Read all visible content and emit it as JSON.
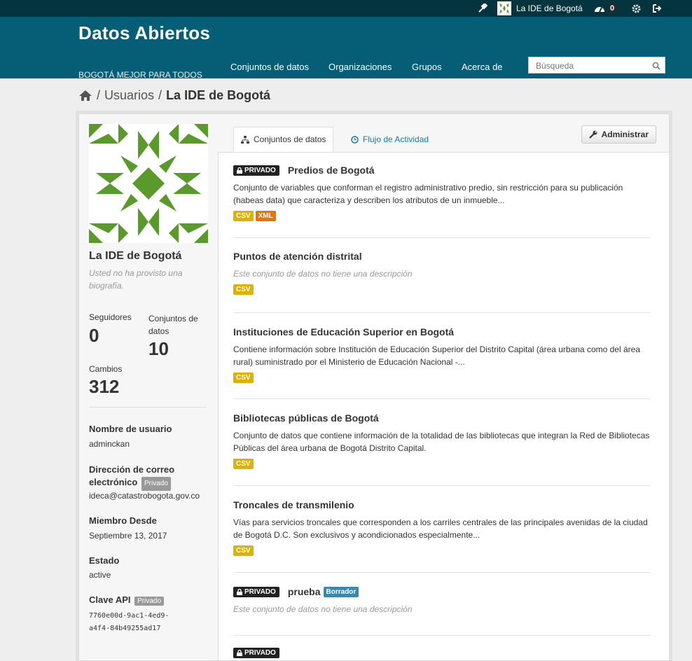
{
  "topbar": {
    "user_name": "La IDE de Bogotá",
    "dashboard_count": "0"
  },
  "header": {
    "site_title": "Datos Abiertos",
    "tagline": "BOGOTÁ MEJOR PARA TODOS",
    "nav": [
      "Conjuntos de datos",
      "Organizaciones",
      "Grupos",
      "Acerca de"
    ],
    "search_placeholder": "Búsqueda"
  },
  "breadcrumb": {
    "separator": "/",
    "users": "Usuarios",
    "current": "La IDE de Bogotá"
  },
  "profile": {
    "name": "La IDE de Bogotá",
    "bio": "Usted no ha provisto una biografía.",
    "followers_label": "Seguidores",
    "followers": "0",
    "datasets_label": "Conjuntos de datos",
    "datasets": "10",
    "changes_label": "Cambios",
    "changes": "312",
    "username_label": "Nombre de usuario",
    "username": "adminckan",
    "email_label": "Dirección de correo electrónico",
    "email_badge": "Privado",
    "email": "ideca@catastrobogota.gov.co",
    "member_label": "Miembro Desde",
    "member_since": "Septiembre 13, 2017",
    "state_label": "Estado",
    "state": "active",
    "api_label": "Clave API",
    "api_badge": "Privado",
    "api_key_line1": "7760e00d-9ac1-4ed9-",
    "api_key_line2": "a4f4-84b49255ad17"
  },
  "tabs": {
    "datasets": "Conjuntos de datos",
    "activity": "Flujo de Actividad",
    "manage": "Administrar"
  },
  "labels": {
    "private": "PRIVADO",
    "draft": "Borrador"
  },
  "datasets": [
    {
      "title": "Predios de Bogotá",
      "desc": "Conjunto de variables que conforman el registro administrativo predio, sin restricción para su publicación (habeas data) que caracteriza y describen los atributos de un inmueble...",
      "formats": [
        "CSV",
        "XML"
      ]
    },
    {
      "title": "Puntos de atención distrital",
      "desc": "Este conjunto de datos no tiene una descripción",
      "formats": [
        "CSV"
      ]
    },
    {
      "title": "Instituciones de Educación Superior en Bogotá",
      "desc": "Contiene información sobre Institución de Educación Superior del Distrito Capital (área urbana como del área rural) suministrado por el Ministerio de Educación Nacional -...",
      "formats": [
        "CSV"
      ]
    },
    {
      "title": "Bibliotecas públicas de Bogotá",
      "desc": "Conjunto de datos que contiene información de la totalidad de las bibliotecas que integran la Red de Bibliotecas Públicas del área urbana de Bogotá Distrito Capital.",
      "formats": [
        "CSV"
      ]
    },
    {
      "title": "Troncales de transmilenio",
      "desc": "Vías para servicios troncales que corresponden a los carriles centrales de las principales avenidas de la ciudad de Bogotá D.C. Son exclusivos y acondicionados especialmente...",
      "formats": [
        "CSV"
      ]
    },
    {
      "title": "prueba",
      "desc": "Este conjunto de datos no tiene una descripción",
      "formats": []
    }
  ],
  "colors": {
    "topbar": "#04343e",
    "masthead": "#055e76",
    "csv": "#dfb100",
    "xml": "#ef7100",
    "avatar_green": "#5a9a2a",
    "link": "#1a7aa0"
  }
}
